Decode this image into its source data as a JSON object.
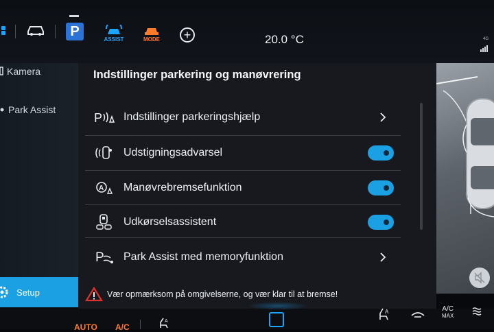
{
  "topbar": {
    "temperature": "20.0 °C",
    "park_label": "P",
    "assist_label": "ASSIST",
    "mode_label": "MODE",
    "signal_label": "4G"
  },
  "sidebar": {
    "items": [
      {
        "label": "Kamera"
      },
      {
        "label": "Park Assist"
      }
    ],
    "setup_label": "Setup"
  },
  "panel": {
    "title": "Indstillinger parkering og manøvrering",
    "rows": [
      {
        "label": "Indstillinger parkeringshjælp",
        "control": "chevron",
        "icon": "park-distance-icon"
      },
      {
        "label": "Udstigningsadvarsel",
        "control": "toggle",
        "state": "on",
        "icon": "exit-warning-icon"
      },
      {
        "label": "Manøvrebremsefunktion",
        "control": "toggle",
        "state": "on",
        "icon": "maneuver-brake-icon"
      },
      {
        "label": "Udkørselsassistent",
        "control": "toggle",
        "state": "on",
        "icon": "exit-assist-icon"
      },
      {
        "label": "Park Assist med memoryfunktion",
        "control": "chevron",
        "icon": "park-memory-icon"
      }
    ]
  },
  "warning": {
    "text": "Vær opmærksom på omgivelserne, og vær klar til at bremse!",
    "icon": "warning-triangle-icon"
  },
  "bottombar": {
    "left_labels": [
      "AUTO",
      "A/C"
    ],
    "ac_max_top": "A/C",
    "ac_max_bottom": "MAX"
  },
  "colors": {
    "accent": "#1ba0e4",
    "warning": "#e0322c",
    "mode": "#ff7a2a"
  }
}
